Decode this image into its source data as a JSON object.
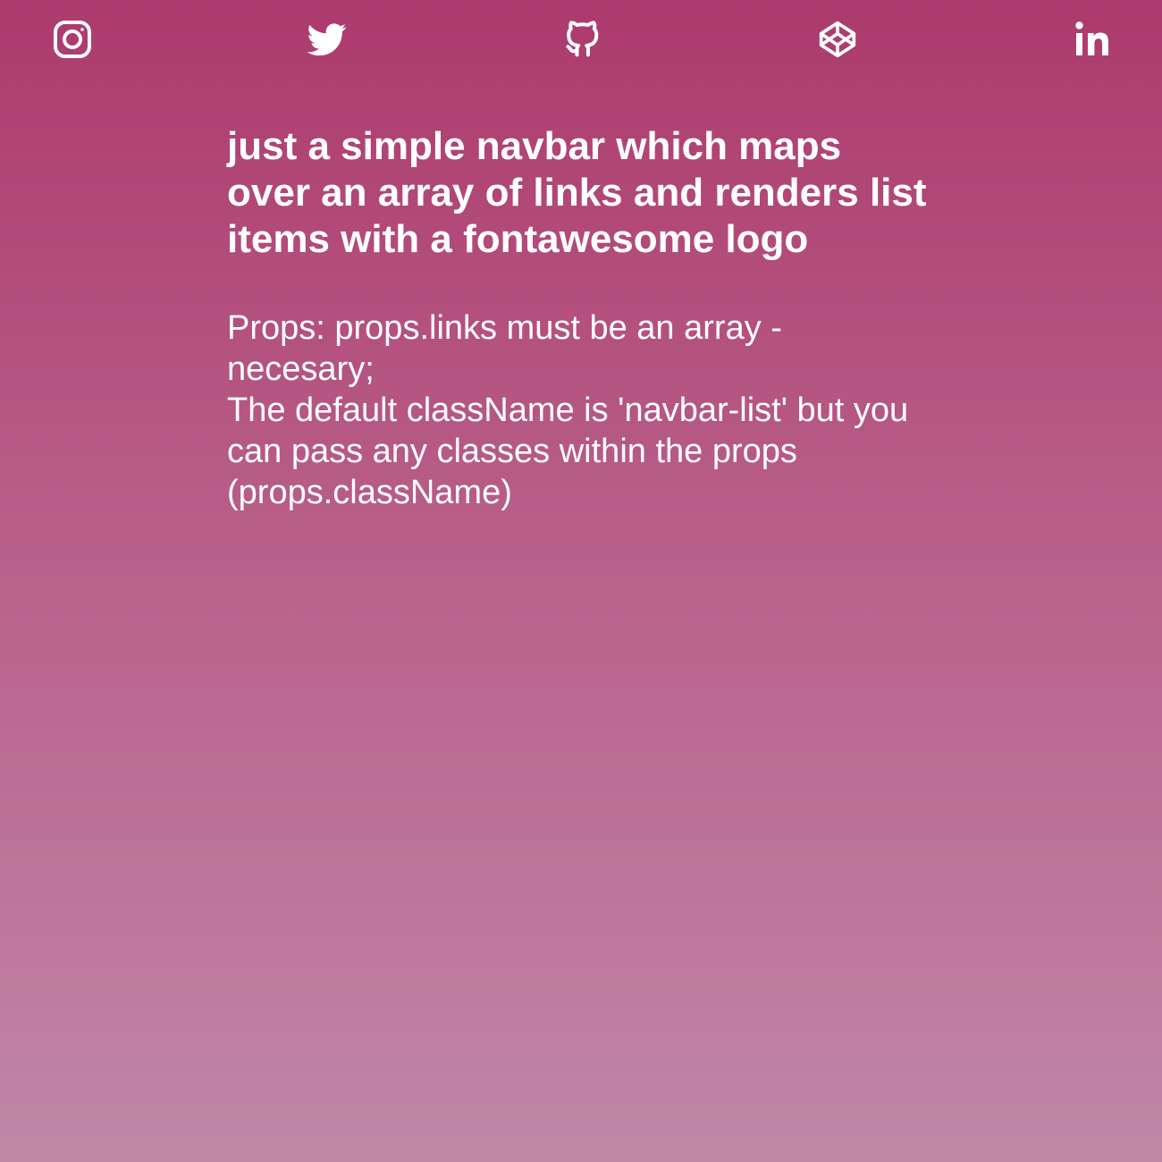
{
  "nav": {
    "links": [
      {
        "icon": "instagram-icon",
        "label": "Instagram"
      },
      {
        "icon": "twitter-icon",
        "label": "Twitter"
      },
      {
        "icon": "github-icon",
        "label": "GitHub"
      },
      {
        "icon": "codepen-icon",
        "label": "CodePen"
      },
      {
        "icon": "linkedin-icon",
        "label": "LinkedIn"
      }
    ]
  },
  "main": {
    "heading": "just a simple navbar which maps over an array of links and renders list items with a fontawesome logo",
    "description": {
      "props_line": "Props: props.links must be an array - necesary;",
      "classname_line": "The default className is 'navbar-list' but you can pass any classes within the props (props.className)"
    }
  },
  "colors": {
    "background_top": "#ac3a6d",
    "background_bottom": "#c087a7",
    "text": "#ffffff"
  }
}
